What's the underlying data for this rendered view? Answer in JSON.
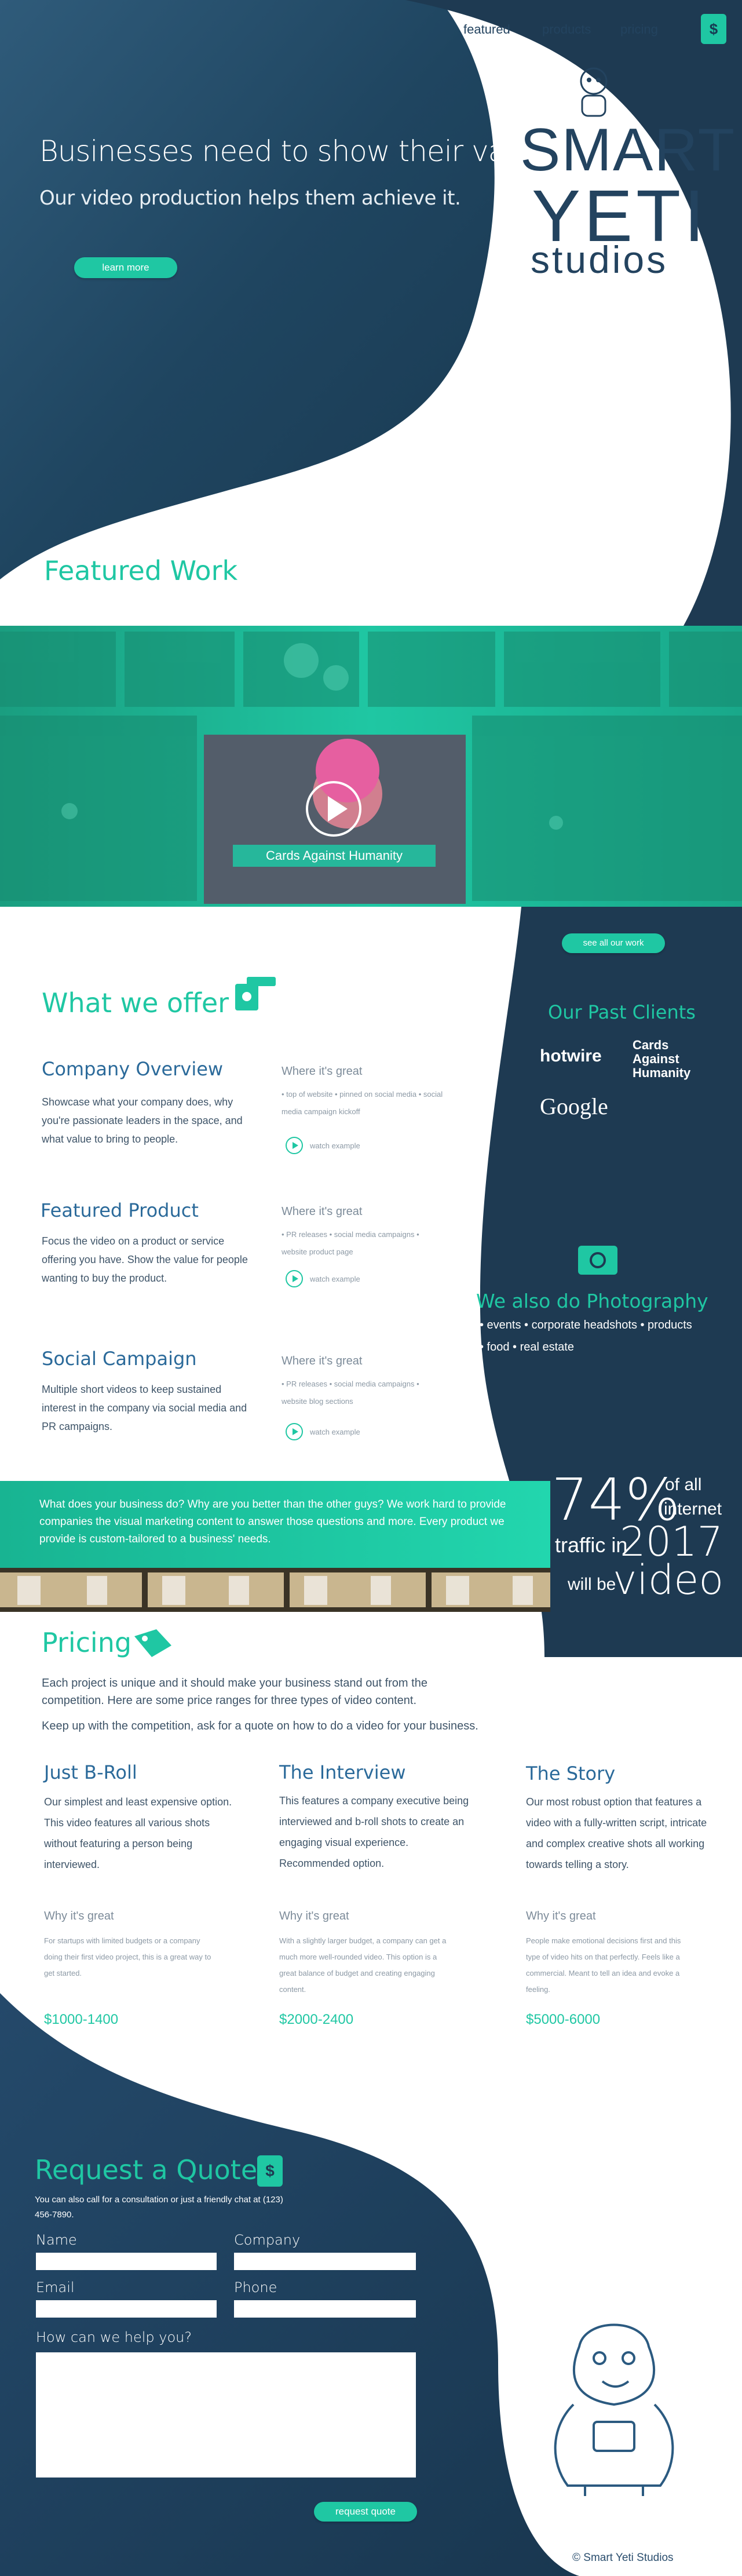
{
  "colors": {
    "navy": "#23435f",
    "teal": "#1fc7a3",
    "dark": "#1e3a52"
  },
  "nav": {
    "items": [
      "featured",
      "products",
      "pricing"
    ],
    "icon": "dollar-chat-icon"
  },
  "hero": {
    "title": "Businesses need to show their value.",
    "subtitle": "Our video production helps them achieve it.",
    "cta": "learn more"
  },
  "logo": {
    "line1": "SMART",
    "line2": "YETI",
    "line3": "studios"
  },
  "featured": {
    "title": "Featured Work",
    "video_caption": "Cards Against Humanity",
    "see_all": "see all our work"
  },
  "offer": {
    "title": "What we offer",
    "icon": "video-camera-icon",
    "items": [
      {
        "title": "Company Overview",
        "text": "Showcase what your company does, why you're passionate leaders in the space, and what value to bring to people.",
        "why": "Where it's great",
        "list": "• top of website  • pinned on social media • social media campaign kickoff",
        "watch": "watch example"
      },
      {
        "title": "Featured Product",
        "text": "Focus the video on a product or service offering you have. Show the value for people wanting to buy the product.",
        "why": "Where it's great",
        "list": "• PR releases  • social media campaigns • website product page",
        "watch": "watch example"
      },
      {
        "title": "Social Campaign",
        "text": "Multiple short videos to keep sustained interest in the company via social media and PR campaigns.",
        "why": "Where it's great",
        "list": "• PR releases  • social media campaigns • website blog sections",
        "watch": "watch example"
      }
    ]
  },
  "clients": {
    "title": "Our Past Clients",
    "logos": [
      "hotwire",
      "Cards Against Humanity",
      "Google"
    ]
  },
  "photo": {
    "title": "We also do Photography",
    "icon": "camera-icon",
    "line1": "• events   • corporate headshots   • products",
    "line2": "• food   • real estate"
  },
  "banner": {
    "text": "What does your business do? Why are you better than the other guys? We work hard to provide companies the visual marketing content to answer those questions and more. Every product we provide is custom-tailored to a business' needs."
  },
  "stat": {
    "percent": "74%",
    "of_all": "of all",
    "internet": "internet",
    "traffic_in": "traffic in",
    "year": "2017",
    "will_be": "will be",
    "video": "video"
  },
  "pricing": {
    "title": "Pricing",
    "icon": "price-tag-icon",
    "intro1": "Each project is unique and it should make your business stand out from the competition.  Here are some price ranges for three types of video content.",
    "intro2": "Keep up with the competition, ask for a quote on how to do a video for your business.",
    "columns": [
      {
        "title": "Just B-Roll",
        "text": "Our simplest and least expensive option. This video features all various shots without featuring a person being interviewed.",
        "why": "Why it's great",
        "detail": "For startups with limited budgets or a company doing their first video project, this is a great way to get started.",
        "price": "$1000-1400"
      },
      {
        "title": "The Interview",
        "text": "This features a company executive being interviewed and b-roll shots to create an engaging visual experience. Recommended option.",
        "why": "Why it's great",
        "detail": "With a slightly larger budget, a company can get a much more well-rounded video. This option is a great balance of budget and creating engaging content.",
        "price": "$2000-2400"
      },
      {
        "title": "The Story",
        "text": "Our most robust option that features a video with a fully-written script, intricate and complex creative shots all working towards telling a story.",
        "why": "Why it's great",
        "detail": "People make emotional decisions first and this type of video hits on that perfectly. Feels like a commercial. Meant to tell an idea and evoke a feeling.",
        "price": "$5000-6000"
      }
    ]
  },
  "quote": {
    "title": "Request a Quote",
    "icon": "dollar-chat-icon",
    "sub": "You can also call for a consultation or just a friendly chat at (123) 456-7890.",
    "name_label": "Name",
    "company_label": "Company",
    "email_label": "Email",
    "phone_label": "Phone",
    "help_label": "How can we help you?",
    "submit": "request quote"
  },
  "footer": {
    "copyright": "© Smart Yeti Studios"
  }
}
